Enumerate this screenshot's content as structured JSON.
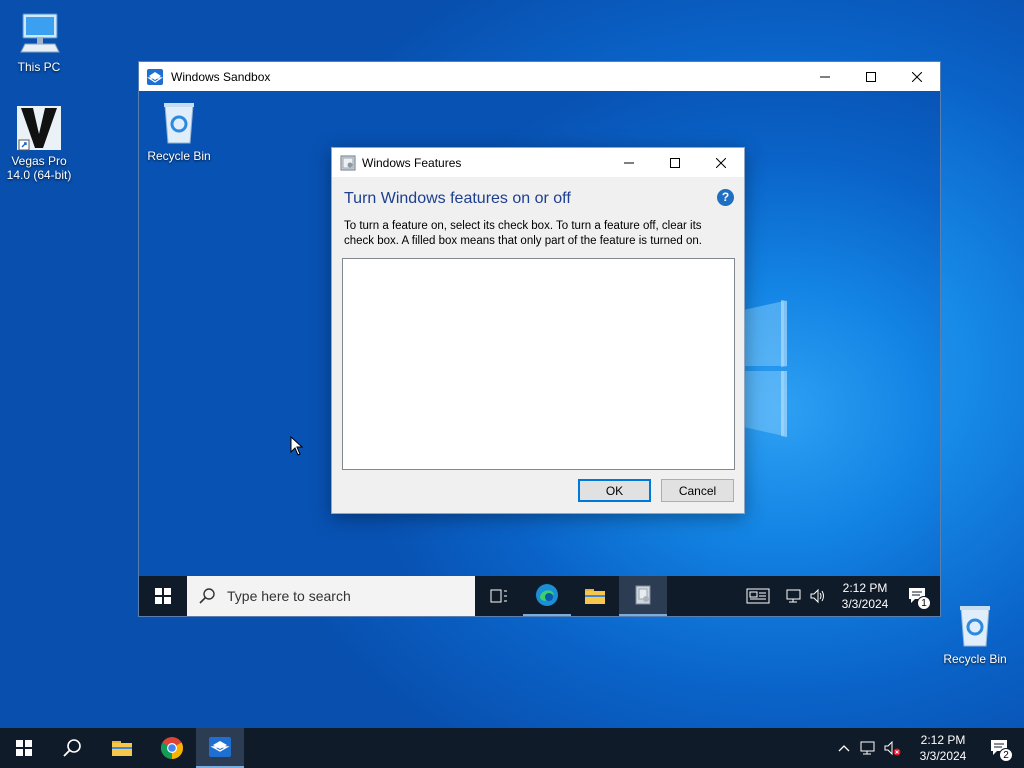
{
  "desktop": {
    "icons": [
      {
        "label": "This PC"
      },
      {
        "label": "Vegas Pro 14.0 (64-bit)"
      },
      {
        "label": "Recycle Bin"
      }
    ]
  },
  "sandbox": {
    "title": "Windows Sandbox",
    "recycle_bin_label": "Recycle Bin",
    "taskbar": {
      "search_placeholder": "Type here to search",
      "time": "2:12 PM",
      "date": "3/3/2024",
      "notification_count": "1"
    }
  },
  "features_dialog": {
    "title": "Windows Features",
    "heading": "Turn Windows features on or off",
    "description": "To turn a feature on, select its check box. To turn a feature off, clear its check box. A filled box means that only part of the feature is turned on.",
    "ok_label": "OK",
    "cancel_label": "Cancel"
  },
  "host_taskbar": {
    "time": "2:12 PM",
    "date": "3/3/2024",
    "notification_count": "2"
  },
  "colors": {
    "accent": "#0078d7",
    "heading": "#1e3e8f",
    "taskbar": "#101b29"
  }
}
